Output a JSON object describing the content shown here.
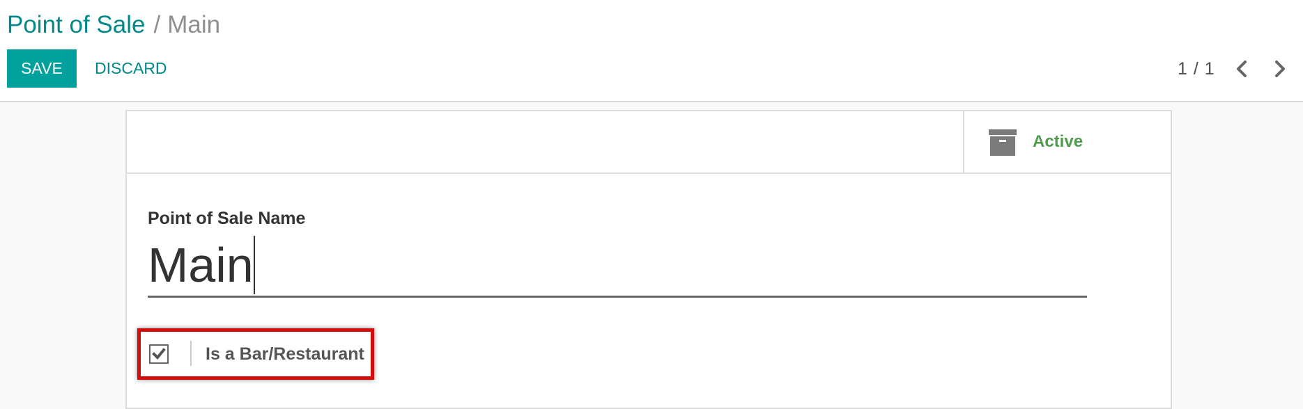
{
  "breadcrumb": {
    "parent": "Point of Sale",
    "separator": "/",
    "current": "Main"
  },
  "toolbar": {
    "save_label": "SAVE",
    "discard_label": "DISCARD"
  },
  "pager": {
    "value": "1 / 1",
    "prev_icon": "chevron-left-icon",
    "next_icon": "chevron-right-icon"
  },
  "button_box": {
    "active_label": "Active",
    "active_icon": "archive-icon",
    "active_color": "#4f9b4e"
  },
  "form": {
    "name_label": "Point of Sale Name",
    "name_value": "Main",
    "is_restaurant_label": "Is a Bar/Restaurant",
    "is_restaurant_checked": true
  },
  "colors": {
    "brand": "#00a09d",
    "link": "#00888a",
    "highlight": "#d40c0c"
  }
}
